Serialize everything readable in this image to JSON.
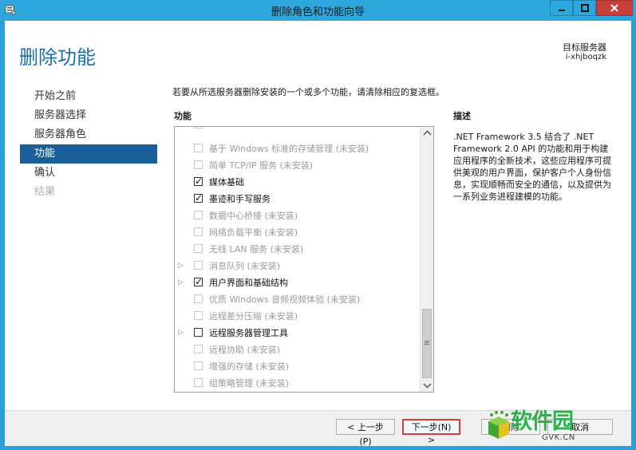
{
  "window": {
    "title": "删除角色和功能向导"
  },
  "header": {
    "page_title": "删除功能",
    "target_label": "目标服务器",
    "target_value": "i-xhjboqzk"
  },
  "nav": {
    "items": [
      {
        "label": "开始之前",
        "state": "normal"
      },
      {
        "label": "服务器选择",
        "state": "normal"
      },
      {
        "label": "服务器角色",
        "state": "normal"
      },
      {
        "label": "功能",
        "state": "active"
      },
      {
        "label": "确认",
        "state": "normal"
      },
      {
        "label": "结果",
        "state": "disabled"
      }
    ]
  },
  "main": {
    "instruction": "若要从所选服务器删除安装的一个或多个功能，请清除相应的复选框。",
    "features_heading": "功能",
    "description_heading": "描述",
    "description": ".NET Framework 3.5 结合了 .NET Framework 2.0 API 的功能和用于构建应用程序的全新技术，这些应用程序可提供美观的用户界面，保护客户个人身份信息，实现顺畅而安全的通信，以及提供为一系列业务进程建模的功能。",
    "features": [
      {
        "label": "基于 Windows 标准的存储管理 (未安装)",
        "checked": false,
        "enabled": false,
        "expandable": false
      },
      {
        "label": "简单 TCP/IP 服务 (未安装)",
        "checked": false,
        "enabled": false,
        "expandable": false
      },
      {
        "label": "媒体基础",
        "checked": true,
        "enabled": true,
        "expandable": false
      },
      {
        "label": "墨迹和手写服务",
        "checked": true,
        "enabled": true,
        "expandable": false
      },
      {
        "label": "数据中心桥接 (未安装)",
        "checked": false,
        "enabled": false,
        "expandable": false
      },
      {
        "label": "网络负载平衡 (未安装)",
        "checked": false,
        "enabled": false,
        "expandable": false
      },
      {
        "label": "无线 LAN 服务 (未安装)",
        "checked": false,
        "enabled": false,
        "expandable": false
      },
      {
        "label": "消息队列 (未安装)",
        "checked": false,
        "enabled": false,
        "expandable": true
      },
      {
        "label": "用户界面和基础结构",
        "checked": true,
        "enabled": true,
        "expandable": true
      },
      {
        "label": "优质 Windows 音频视频体验 (未安装)",
        "checked": false,
        "enabled": false,
        "expandable": false
      },
      {
        "label": "远程差分压缩 (未安装)",
        "checked": false,
        "enabled": false,
        "expandable": false
      },
      {
        "label": "远程服务器管理工具",
        "checked": false,
        "enabled": true,
        "expandable": true
      },
      {
        "label": "远程协助 (未安装)",
        "checked": false,
        "enabled": false,
        "expandable": false
      },
      {
        "label": "增强的存储 (未安装)",
        "checked": false,
        "enabled": false,
        "expandable": false
      },
      {
        "label": "组策略管理 (未安装)",
        "checked": false,
        "enabled": false,
        "expandable": false
      }
    ]
  },
  "footer": {
    "prev_label": "< 上一步(P)",
    "next_label": "下一步(N) >",
    "install_label": "删除",
    "cancel_label": "取消"
  },
  "watermark": {
    "text": "软件园",
    "sub": "GVK.CN"
  },
  "colors": {
    "titlebar": "#2ea8dc",
    "active_nav": "#1a5f9a",
    "title_text": "#1d6fa8",
    "highlight_border": "#e23a3a",
    "close_button": "#c7403a",
    "watermark": "#2bb24c"
  }
}
